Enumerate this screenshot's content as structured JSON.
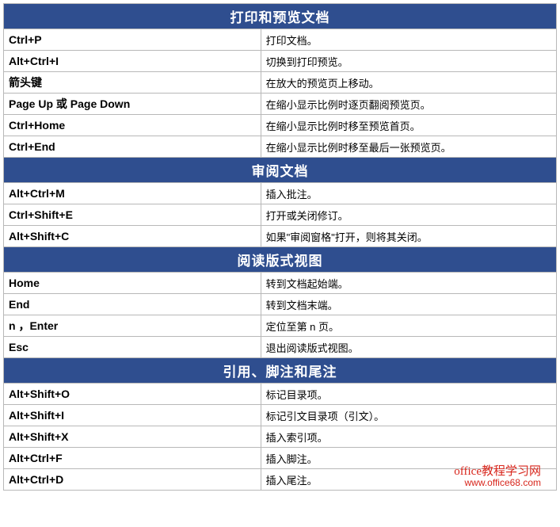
{
  "sections": [
    {
      "title": "打印和预览文档",
      "rows": [
        {
          "shortcut": "Ctrl+P",
          "desc": "打印文档。"
        },
        {
          "shortcut": "Alt+Ctrl+I",
          "desc": "切换到打印预览。"
        },
        {
          "shortcut": "箭头键",
          "desc": "在放大的预览页上移动。"
        },
        {
          "shortcut": "Page Up 或 Page Down",
          "desc": "在缩小显示比例时逐页翻阅预览页。"
        },
        {
          "shortcut": "Ctrl+Home",
          "desc": "在缩小显示比例时移至预览首页。"
        },
        {
          "shortcut": "Ctrl+End",
          "desc": "在缩小显示比例时移至最后一张预览页。"
        }
      ]
    },
    {
      "title": "审阅文档",
      "rows": [
        {
          "shortcut": "Alt+Ctrl+M",
          "desc": "插入批注。"
        },
        {
          "shortcut": "Ctrl+Shift+E",
          "desc": "打开或关闭修订。"
        },
        {
          "shortcut": "Alt+Shift+C",
          "desc": "如果\"审阅窗格\"打开，则将其关闭。"
        }
      ]
    },
    {
      "title": "阅读版式视图",
      "rows": [
        {
          "shortcut": "Home",
          "desc": "转到文档起始端。"
        },
        {
          "shortcut": "End",
          "desc": "转到文档末端。"
        },
        {
          "shortcut": "n ，Enter",
          "desc": "定位至第 n 页。"
        },
        {
          "shortcut": "Esc",
          "desc": "退出阅读版式视图。"
        }
      ]
    },
    {
      "title": "引用、脚注和尾注",
      "rows": [
        {
          "shortcut": "Alt+Shift+O",
          "desc": "标记目录项。"
        },
        {
          "shortcut": "Alt+Shift+I",
          "desc": "标记引文目录项（引文）。"
        },
        {
          "shortcut": "Alt+Shift+X",
          "desc": "插入索引项。"
        },
        {
          "shortcut": "Alt+Ctrl+F",
          "desc": "插入脚注。"
        },
        {
          "shortcut": "Alt+Ctrl+D",
          "desc": "插入尾注。"
        }
      ]
    }
  ],
  "footer": {
    "line1": "office教程学习网",
    "line2": "www.office68.com"
  }
}
